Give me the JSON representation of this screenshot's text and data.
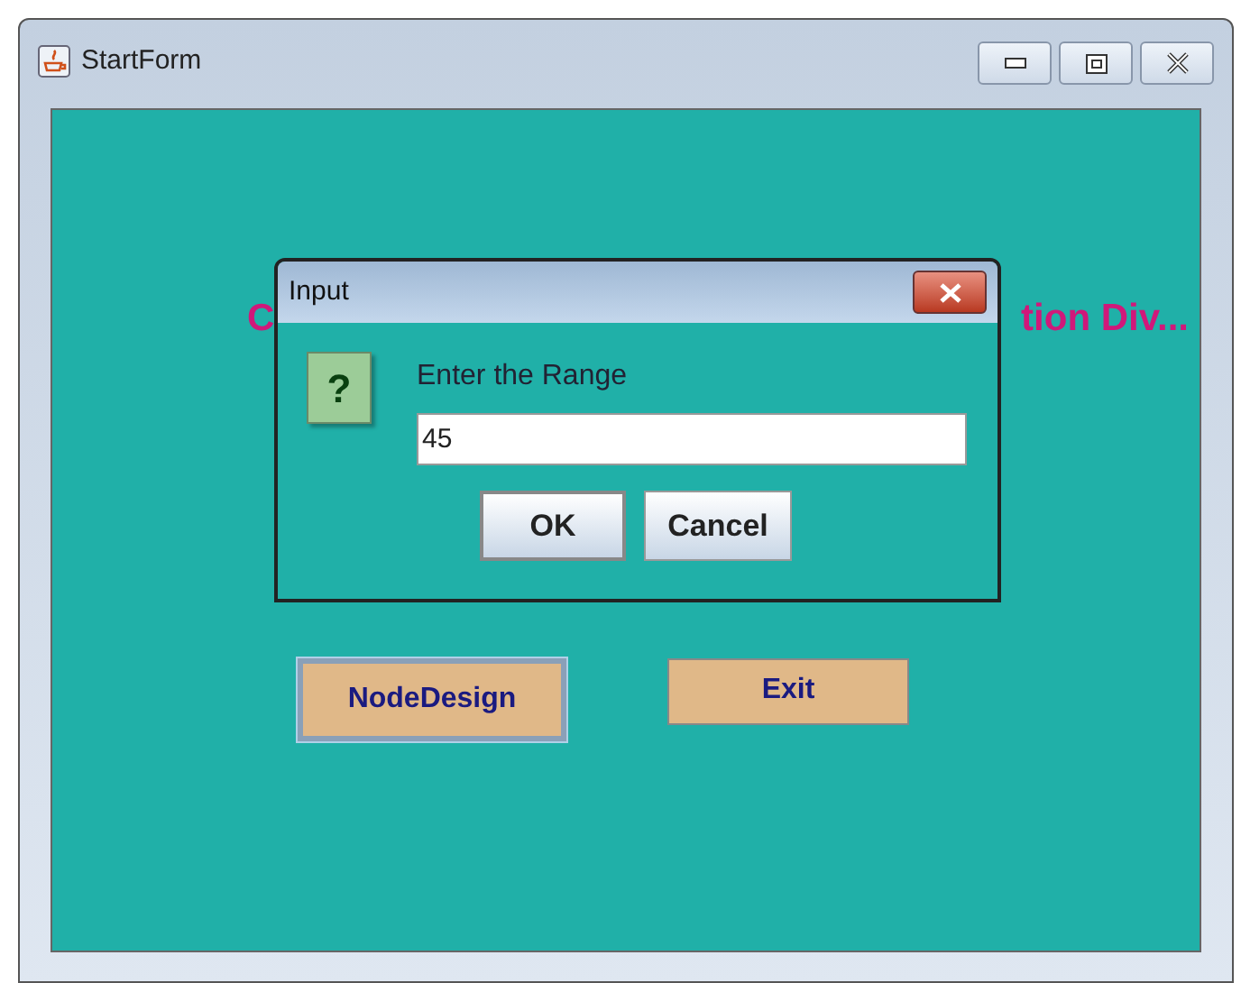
{
  "window": {
    "title": "StartForm"
  },
  "heading": {
    "visible_start": "C",
    "visible_end": "tion Div..."
  },
  "buttons": [
    {
      "label": "NodeDesign",
      "focused": true
    },
    {
      "label": "Exit",
      "focused": false
    }
  ],
  "dialog": {
    "title": "Input",
    "icon": "?",
    "prompt": "Enter the Range",
    "value": "45",
    "buttons": [
      {
        "label": "OK",
        "default": true
      },
      {
        "label": "Cancel",
        "default": false
      }
    ]
  }
}
